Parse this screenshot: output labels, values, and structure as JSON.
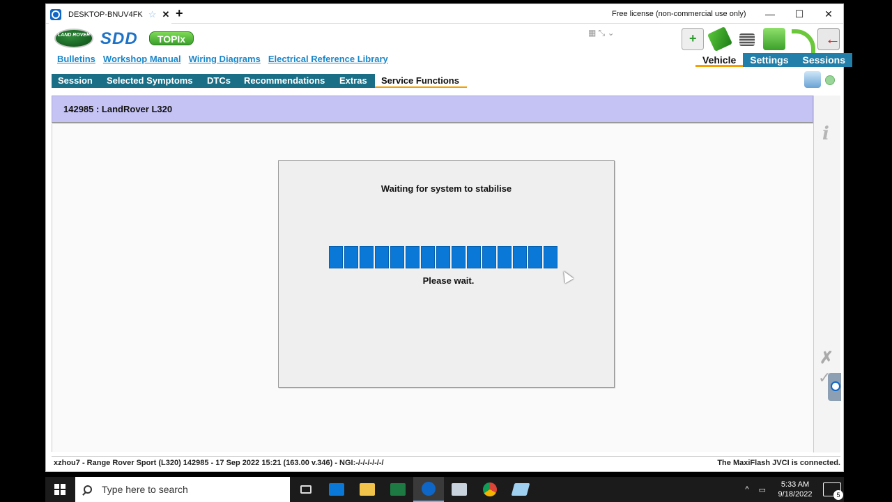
{
  "teamviewer": {
    "tab_title": "DESKTOP-BNUV4FK",
    "new_tab": "+",
    "license": "Free license (non-commercial use only)",
    "window_controls": {
      "minimize": "—",
      "maximize": "☐",
      "close": "✕"
    }
  },
  "brand": {
    "land_rover": "LAND ROVER",
    "sdd": "SDD",
    "topix": "TOPIx"
  },
  "top_links": [
    "Bulletins",
    "Workshop Manual",
    "Wiring Diagrams",
    "Electrical Reference Library"
  ],
  "right_tabs": [
    "Vehicle",
    "Settings",
    "Sessions"
  ],
  "main_tabs": [
    "Session",
    "Selected Symptoms",
    "DTCs",
    "Recommendations",
    "Extras",
    "Service Functions"
  ],
  "active_main_tab": "Service Functions",
  "vehicle_header": "142985 : LandRover L320",
  "dialog": {
    "title": "Waiting for system to stabilise",
    "wait_text": "Please wait.",
    "progress_segments": 15,
    "progress_fraction": 1.0,
    "progress_color": "#0a78d7"
  },
  "status": {
    "left": "xzhou7 - Range Rover Sport (L320) 142985 - 17 Sep 2022 15:21 (163.00 v.346) - NGI:-/-/-/-/-/-/",
    "right": "The MaxiFlash JVCI is connected."
  },
  "taskbar": {
    "search_placeholder": "Type here to search",
    "apps": [
      "task-view-icon",
      "mail-icon",
      "file-explorer-icon",
      "excel-icon",
      "teamviewer-icon",
      "app-window-icon",
      "chrome-icon",
      "sdd-icon"
    ],
    "time": "5:33 AM",
    "date": "9/18/2022",
    "notifications": "5"
  },
  "colors": {
    "accent_teal": "#1a6f86",
    "header_lavender": "#c4c3f4",
    "tab_underline": "#f5a000",
    "link_blue": "#1b86c9"
  }
}
